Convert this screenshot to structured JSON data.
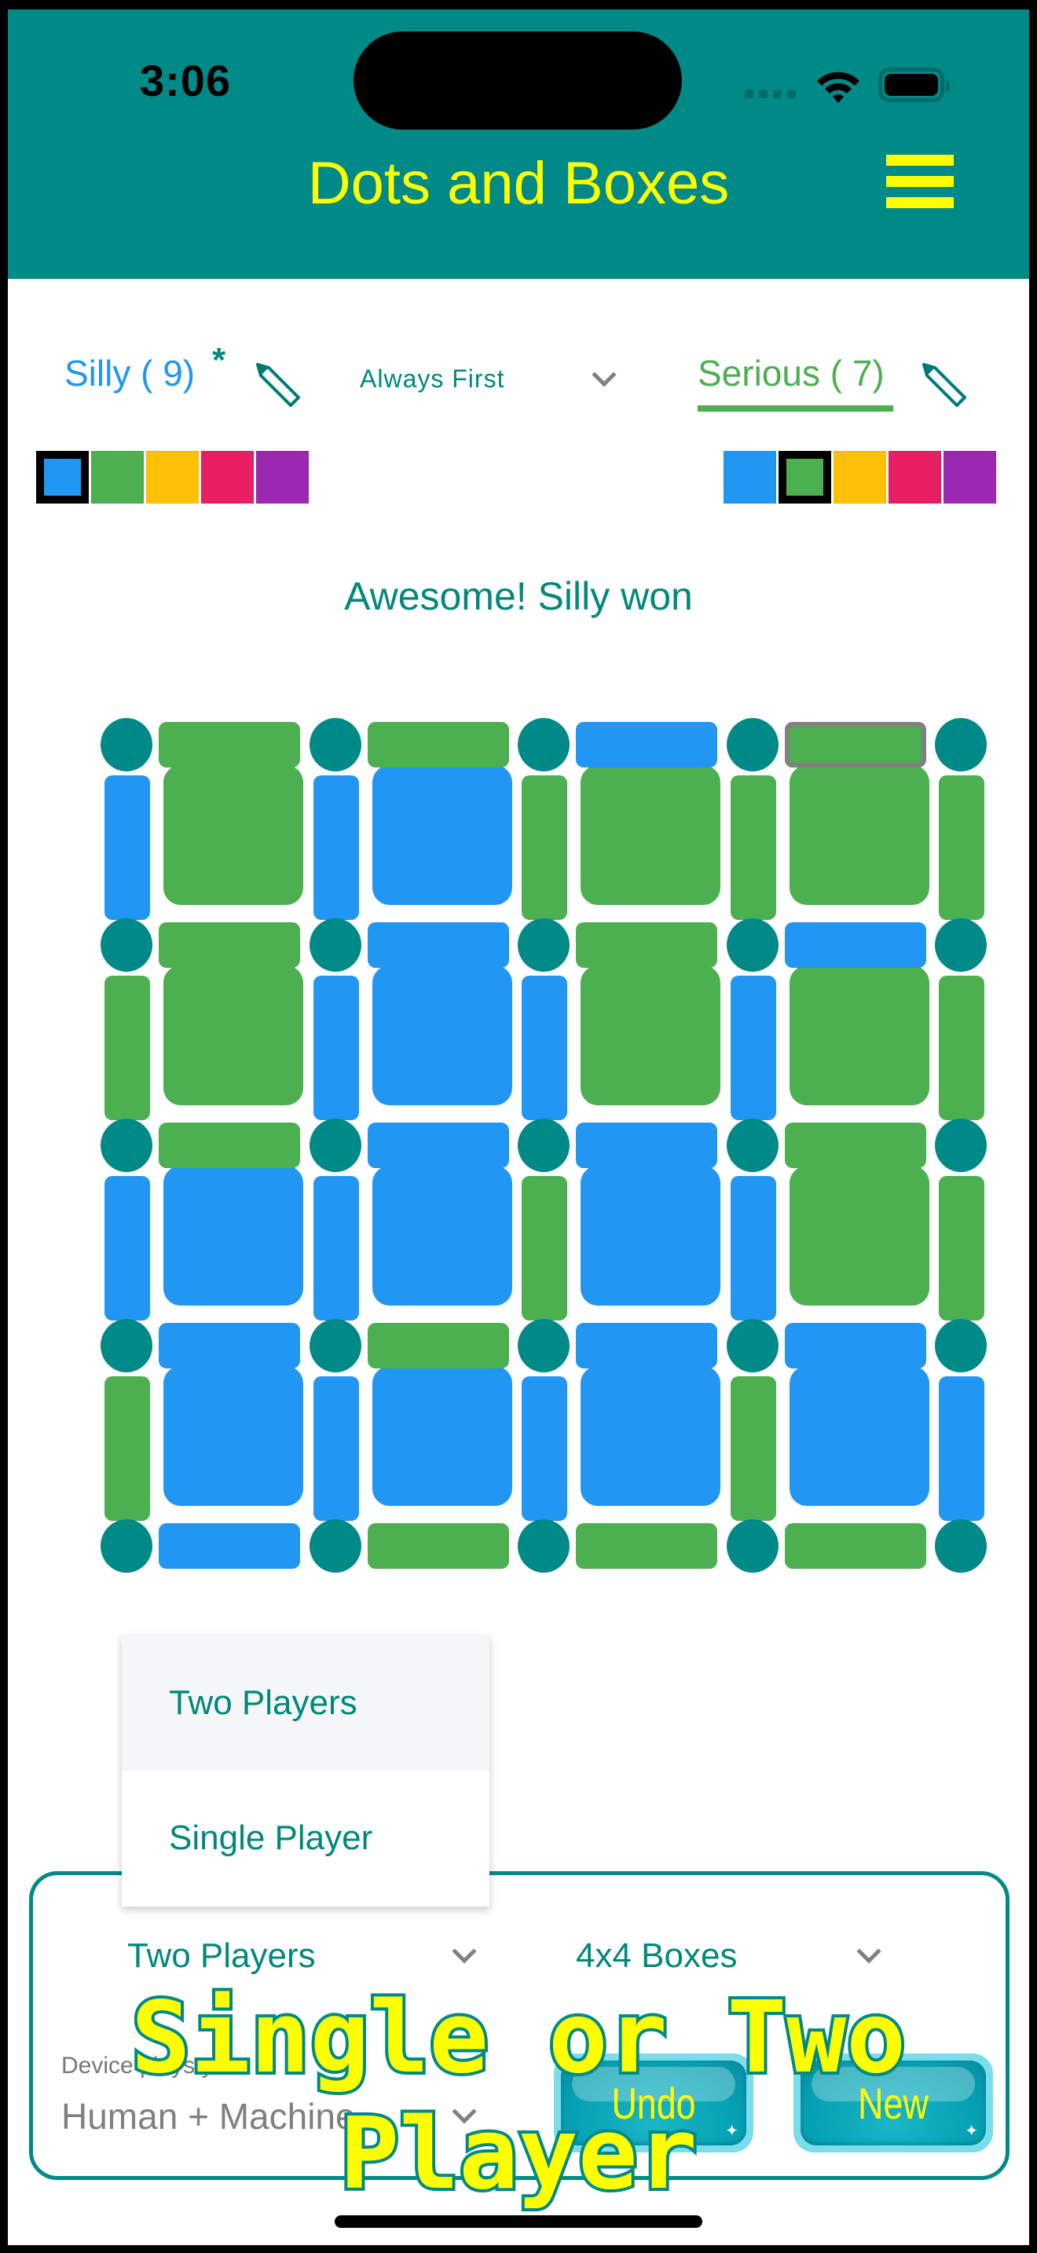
{
  "status_bar": {
    "time": "3:06",
    "wifi_icon": "wifi-icon",
    "battery_icon": "battery-icon"
  },
  "app_bar": {
    "title": "Dots and Boxes",
    "menu_icon": "hamburger-menu-icon"
  },
  "players": {
    "left": {
      "name": "Silly",
      "score": 9,
      "label": "Silly ( 9)",
      "current_marker": "*",
      "color": "#2196f3",
      "edit_icon": "pencil-icon"
    },
    "right": {
      "name": "Serious",
      "score": 7,
      "label": "Serious ( 7)",
      "color": "#4caf50",
      "edit_icon": "pencil-icon"
    },
    "first_move_select": {
      "value": "Always First"
    }
  },
  "palette": [
    "#2196f3",
    "#4caf50",
    "#ffc107",
    "#e91e63",
    "#9c27b0"
  ],
  "left_selected_color_index": 0,
  "right_selected_color_index": 1,
  "message": "Awesome! Silly won",
  "board": {
    "size": "4x4",
    "dot_color": "#008a87",
    "owner_colors": {
      "B": "#2196f3",
      "G": "#4caf50"
    },
    "horizontal_lines": [
      [
        "G",
        "G",
        "B",
        "G"
      ],
      [
        "G",
        "B",
        "G",
        "B"
      ],
      [
        "G",
        "B",
        "B",
        "G"
      ],
      [
        "B",
        "G",
        "B",
        "B"
      ],
      [
        "B",
        "G",
        "G",
        "G"
      ]
    ],
    "vertical_lines": [
      [
        "B",
        "B",
        "G",
        "G",
        "G"
      ],
      [
        "G",
        "B",
        "B",
        "B",
        "G"
      ],
      [
        "B",
        "B",
        "G",
        "B",
        "G"
      ],
      [
        "G",
        "B",
        "B",
        "G",
        "B"
      ]
    ],
    "boxes": [
      [
        "G",
        "B",
        "G",
        "G"
      ],
      [
        "G",
        "B",
        "G",
        "G"
      ],
      [
        "B",
        "B",
        "B",
        "G"
      ],
      [
        "B",
        "B",
        "B",
        "B"
      ]
    ],
    "last_move": {
      "type": "horizontal",
      "row": 0,
      "col": 3
    }
  },
  "dropdown": {
    "options": [
      "Two Players",
      "Single Player"
    ],
    "highlighted_index": 0
  },
  "controls": {
    "mode_select": {
      "value": "Two Players"
    },
    "size_select": {
      "value": "4x4 Boxes"
    },
    "playstyle_label": "Device playstyle",
    "playstyle_select": {
      "value": "Human + Machine"
    },
    "undo_label": "Undo",
    "new_label": "New"
  },
  "caption": {
    "line1": "Single or Two",
    "line2": "Player"
  }
}
